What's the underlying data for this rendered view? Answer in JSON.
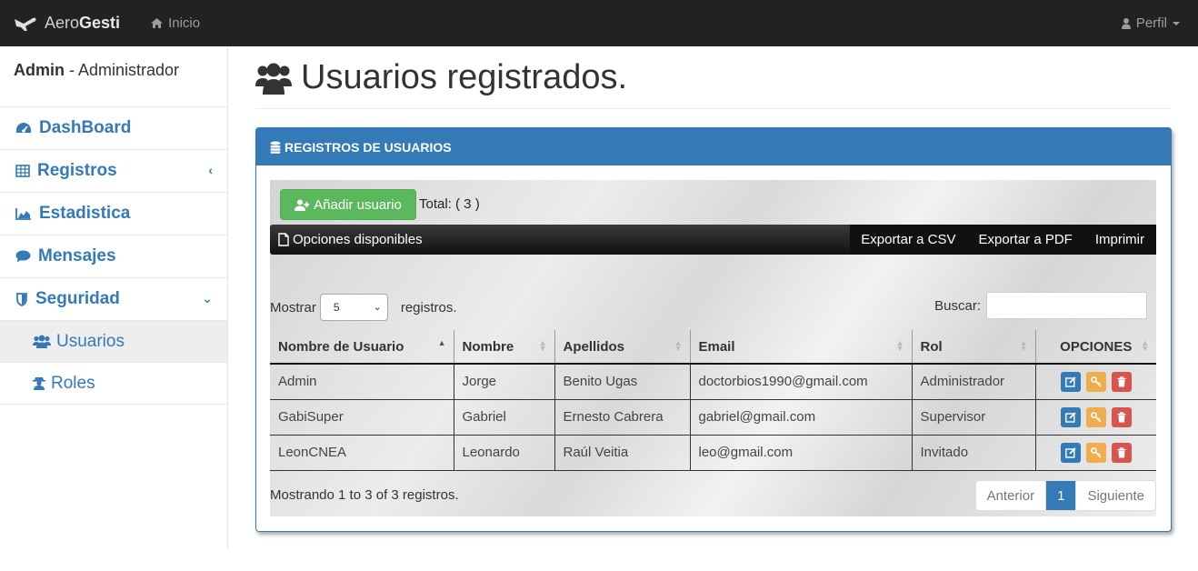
{
  "brand": {
    "light": "Aero",
    "bold": "Gesti"
  },
  "nav": {
    "home": "Inicio",
    "profile": "Perfil"
  },
  "sidebar": {
    "user_name": "Admin",
    "user_role": " - Administrador",
    "items": [
      {
        "label": "DashBoard",
        "icon": "dashboard-icon"
      },
      {
        "label": "Registros",
        "icon": "table-icon"
      },
      {
        "label": "Estadistica",
        "icon": "area-chart-icon"
      },
      {
        "label": "Mensajes",
        "icon": "comment-icon"
      },
      {
        "label": "Seguridad",
        "icon": "shield-icon"
      }
    ],
    "sub_items": [
      {
        "label": "Usuarios",
        "icon": "users-icon",
        "active": true
      },
      {
        "label": "Roles",
        "icon": "user-secret-icon",
        "active": false
      }
    ]
  },
  "page": {
    "title": "Usuarios registrados."
  },
  "panel": {
    "heading": "REGISTROS DE USUARIOS",
    "add_button": "Añadir usuario",
    "total": "Total: ( 3 )",
    "options_label": "Opciones disponibles",
    "export_csv": "Exportar a CSV",
    "export_pdf": "Exportar a PDF",
    "print": "Imprimir",
    "show_label": "Mostrar",
    "show_value": "5",
    "records_label": "registros.",
    "search_label": "Buscar:",
    "columns": [
      "Nombre de Usuario",
      "Nombre",
      "Apellidos",
      "Email",
      "Rol",
      "OPCIONES"
    ],
    "rows": [
      [
        "Admin",
        "Jorge",
        "Benito Ugas",
        "doctorbios1990@gmail.com",
        "Administrador"
      ],
      [
        "GabiSuper",
        "Gabriel",
        "Ernesto Cabrera",
        "gabriel@gmail.com",
        "Supervisor"
      ],
      [
        "LeonCNEA",
        "Leonardo",
        "Raúl Veitia",
        "leo@gmail.com",
        "Invitado"
      ]
    ],
    "info": "Mostrando 1 to 3 of 3 registros.",
    "pager": {
      "prev": "Anterior",
      "current": "1",
      "next": "Siguiente"
    }
  },
  "colors": {
    "primary": "#337ab7",
    "success": "#5cb85c",
    "warning": "#f0ad4e",
    "danger": "#d9534f",
    "navbar": "#222222"
  }
}
